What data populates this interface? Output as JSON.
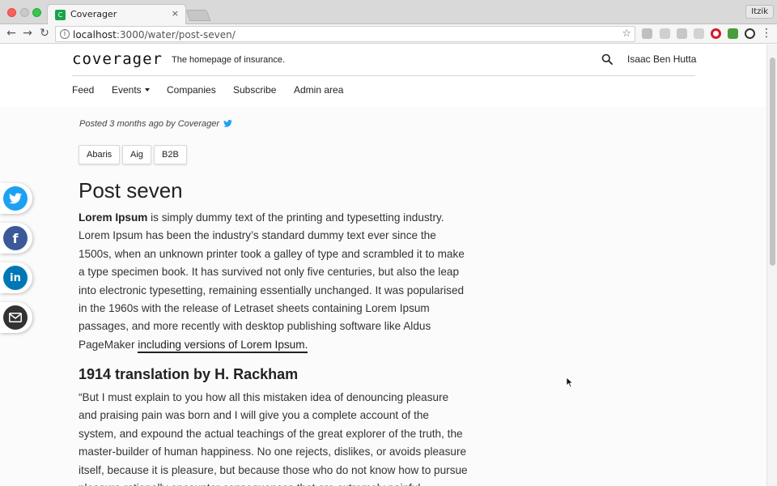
{
  "browser": {
    "tab_title": "Coverager",
    "tab_favicon_letter": "C",
    "close_glyph": "×",
    "profile_name": "Itzik",
    "url_host": "localhost",
    "url_path": ":3000/water/post-seven/",
    "back_glyph": "←",
    "forward_glyph": "→",
    "reload_glyph": "↻",
    "star_glyph": "☆",
    "menu_glyph": "⋮",
    "extension_icons": [
      "extension-icon-1",
      "extension-icon-2",
      "extension-icon-3",
      "extension-icon-4",
      "opera-icon",
      "tree-icon",
      "blocker-icon"
    ]
  },
  "header": {
    "logo": "coverager",
    "tagline": "The homepage of insurance.",
    "user_name": "Isaac Ben Hutta",
    "nav": [
      "Feed",
      "Events",
      "Companies",
      "Subscribe",
      "Admin area"
    ]
  },
  "share": {
    "items": [
      {
        "name": "twitter",
        "glyph": "🐦",
        "color": "#1da1f2"
      },
      {
        "name": "facebook",
        "glyph": "f",
        "color": "#3b5998"
      },
      {
        "name": "linkedin",
        "glyph": "in",
        "color": "#0077b5"
      },
      {
        "name": "email",
        "glyph": "✉",
        "color": "#333333"
      }
    ]
  },
  "post": {
    "meta": "Posted 3 months ago by Coverager",
    "tags": [
      "Abaris",
      "Aig",
      "B2B"
    ],
    "title": "Post seven",
    "lead_bold": "Lorem Ipsum",
    "lead_text": " is simply dummy text of the printing and typesetting industry. Lorem Ipsum has been the industry’s standard dummy text  ever since the 1500s, when an unknown printer took a galley of type and scrambled it to make a type specimen book. It has survived not only five centuries, but also the leap into electronic typesetting, remaining essentially unchanged. It was popularised in the 1960s with the release of Letraset sheets containing Lorem Ipsum passages, and more recently with desktop publishing software like Aldus PageMaker ",
    "lead_link": "including versions of Lorem Ipsum.",
    "subheading": "1914 translation by H. Rackham",
    "quote": "“But I must explain to you how all this mistaken idea of denouncing pleasure and praising pain was born and I will give you a complete account of the system, and expound the actual teachings of the great explorer of the truth, the master-builder of human happiness. No one rejects, dislikes, or avoids pleasure itself, because it is pleasure, but because those who do not know how to pursue pleasure rationally encounter consequences that are extremely painful."
  },
  "colors": {
    "twitter": "#1da1f2",
    "facebook": "#3b5998",
    "linkedin": "#0077b5",
    "email": "#333333"
  }
}
